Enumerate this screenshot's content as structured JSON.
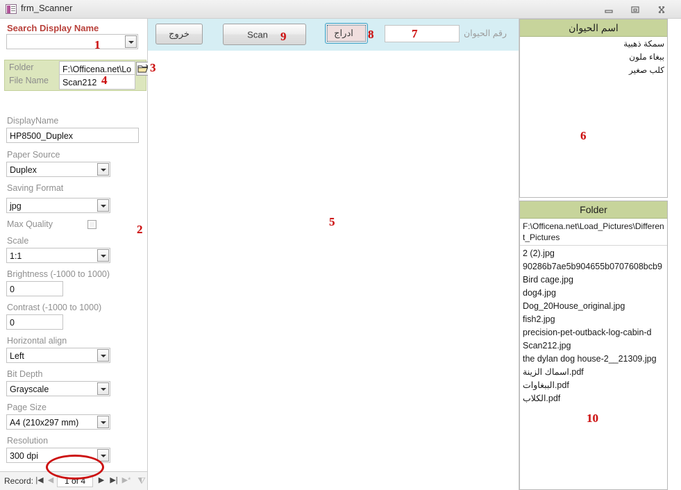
{
  "window": {
    "title": "frm_Scanner",
    "icon": "access-form-icon",
    "buttons": {
      "minimize": "minimize-icon",
      "restore": "restore-icon",
      "close": "close-icon"
    }
  },
  "colors": {
    "accent_green_header": "#c7d49b",
    "green_panel": "#dce6bd",
    "command_strip_blue": "#d6eef4",
    "marker_red": "#cc1111",
    "label_red": "#b8403a",
    "label_gray": "#8f8f8f"
  },
  "left_panel": {
    "search": {
      "label": "Search Display Name",
      "value": "",
      "placeholder": ""
    },
    "folder_group": {
      "folder_label": "Folder",
      "folder_value": "F:\\Officena.net\\Lo",
      "file_name_label": "File Name",
      "file_name_value": "Scan212",
      "browse_icon": "open-folder-icon"
    },
    "fields": [
      {
        "label": "DisplayName",
        "value": "HP8500_Duplex",
        "type": "textbox"
      },
      {
        "label": "Paper Source",
        "value": "Duplex",
        "type": "combo"
      },
      {
        "label": "Saving Format",
        "value": "jpg",
        "type": "combo"
      },
      {
        "label": "Max Quality",
        "value": "",
        "type": "checkbox",
        "checked": false
      },
      {
        "label": "Scale",
        "value": "1:1",
        "type": "combo"
      },
      {
        "label": "Brightness (-1000 to 1000)",
        "value": "0",
        "type": "textbox"
      },
      {
        "label": "Contrast   (-1000 to 1000)",
        "value": "0",
        "type": "textbox"
      },
      {
        "label": "Horizontal align",
        "value": "Left",
        "type": "combo"
      },
      {
        "label": "Bit Depth",
        "value": "Grayscale",
        "type": "combo"
      },
      {
        "label": "Page Size",
        "value": "A4 (210x297 mm)",
        "type": "combo"
      },
      {
        "label": "Resolution",
        "value": "300 dpi",
        "type": "combo"
      }
    ],
    "record_nav": {
      "label": "Record:",
      "first": "first-record-icon",
      "previous": "previous-record-icon",
      "position": "1 of 4",
      "next": "next-record-icon",
      "last": "last-record-icon",
      "new": "new-record-icon",
      "filter": "no-filter-icon"
    }
  },
  "command_bar": {
    "exit_button": "خروج",
    "scan_button": "Scan",
    "insert_button": "ادراج",
    "animal_number_label": "رقم الحيوان",
    "animal_number_value": ""
  },
  "right_panel": {
    "animal_subform": {
      "header": "اسم الحيوان",
      "rows": [
        "سمكة ذهبية",
        "ببغاء ملون",
        "كلب صغير"
      ]
    },
    "folder_subform": {
      "header": "Folder",
      "path": "F:\\Officena.net\\Load_Pictures\\Different_Pictures",
      "files": [
        "2 (2).jpg",
        "90286b7ae5b904655b0707608bcb9",
        "Bird cage.jpg",
        "dog4.jpg",
        "Dog_20House_original.jpg",
        "fish2.jpg",
        "precision-pet-outback-log-cabin-d",
        "Scan212.jpg",
        "the dylan dog house-2__21309.jpg",
        "اسماك الزينة.pdf",
        "الببغاوات.pdf",
        "الكلاب.pdf"
      ]
    }
  },
  "annotations": {
    "m1": "1",
    "m2": "2",
    "m3": "3",
    "m4": "4",
    "m5": "5",
    "m6": "6",
    "m7": "7",
    "m8": "8",
    "m9": "9",
    "m10": "10"
  }
}
